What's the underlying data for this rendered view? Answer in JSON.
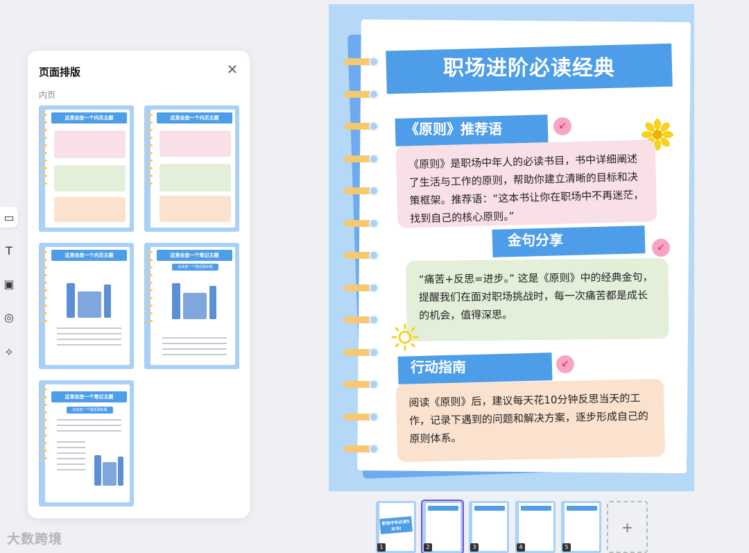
{
  "panel": {
    "title": "页面排版",
    "close_icon": "close-icon",
    "section_label": "内页",
    "templates": [
      {
        "title": "这里会放一个内页主题"
      },
      {
        "title": "这里会放一个内页主题"
      },
      {
        "title": "这里会放一个内页主题"
      },
      {
        "title": "这里会放一个笔记主题",
        "subtitle": "这会放一个描述副标题"
      },
      {
        "title": "这里会放一个笔记主题",
        "subtitle": "这会放一个描述副标题"
      }
    ]
  },
  "toolbar": {
    "tools": [
      {
        "icon": "layout-icon",
        "glyph": "▭"
      },
      {
        "icon": "text-icon",
        "glyph": "T"
      },
      {
        "icon": "image-icon",
        "glyph": "▣"
      },
      {
        "icon": "shapes-icon",
        "glyph": "◎"
      },
      {
        "icon": "sparkle-icon",
        "glyph": "✧"
      }
    ]
  },
  "document": {
    "title": "职场进阶必读经典",
    "sections": [
      {
        "heading": "《原则》推荐语",
        "body": "《原则》是职场中年人的必读书目，书中详细阐述了生活与工作的原则，帮助你建立清晰的目标和决策框架。推荐语：“这本书让你在职场中不再迷茫，找到自己的核心原则。”"
      },
      {
        "heading": "金句分享",
        "body": "“痛苦+反思=进步。” 这是《原则》中的经典金句，提醒我们在面对职场挑战时，每一次痛苦都是成长的机会，值得深思。"
      },
      {
        "heading": "行动指南",
        "body": "阅读《原则》后，建议每天花10分钟反思当天的工作，记录下遇到的问题和解决方案，逐步形成自己的原则体系。"
      }
    ],
    "arrow_glyph": "↙"
  },
  "thumbnails": [
    {
      "num": "1",
      "cover_text": "职场中年必读5本书!"
    },
    {
      "num": "2"
    },
    {
      "num": "3"
    },
    {
      "num": "4"
    },
    {
      "num": "5"
    }
  ],
  "add_page_label": "+",
  "watermark": "大数跨境",
  "colors": {
    "accent_blue": "#4d9de8",
    "doc_bg": "#b5d8f6",
    "ring": "#f6c870",
    "pink_card": "#f9e0e6",
    "green_card": "#e3efd9",
    "peach_card": "#fbe2cf",
    "selected_outline": "#7a4fd6"
  }
}
